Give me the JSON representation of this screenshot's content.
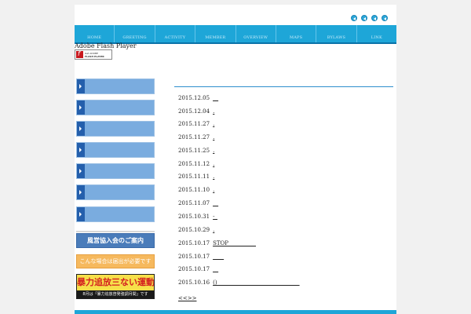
{
  "nav": {
    "items": [
      {
        "label": "HOME"
      },
      {
        "label": "GREETING"
      },
      {
        "label": "ACTIVITY"
      },
      {
        "label": "MEMBER"
      },
      {
        "label": "OVERVIEW"
      },
      {
        "label": "MAPS"
      },
      {
        "label": "BYLAWS"
      },
      {
        "label": "LINK"
      }
    ]
  },
  "flash": {
    "text": "Adobe Flash Player",
    "logo_line1": "Get ADOBE",
    "logo_line2": "FLASH PLAYER"
  },
  "sidebar": {
    "menu_count": 7,
    "banners": {
      "banner1": "風営協入会のご案内",
      "banner2": "こんな場合は届出が必要です",
      "banner3_main": "暴力追放三ない運動+1",
      "banner3_sub": "8月は「暴力追放啓発強調月間」です"
    }
  },
  "news": {
    "items": [
      {
        "date": "2015.12.05",
        "title": "__"
      },
      {
        "date": "2015.12.04",
        "title": "."
      },
      {
        "date": "2015.11.27",
        "title": "."
      },
      {
        "date": "2015.11.27",
        "title": "."
      },
      {
        "date": "2015.11.25",
        "title": "."
      },
      {
        "date": "2015.11.12",
        "title": "."
      },
      {
        "date": "2015.11.11",
        "title": "."
      },
      {
        "date": "2015.11.10",
        "title": "."
      },
      {
        "date": "2015.11.07",
        "title": "__"
      },
      {
        "date": "2015.10.31",
        "title": "-_"
      },
      {
        "date": "2015.10.29",
        "title": "."
      },
      {
        "date": "2015.10.17",
        "title": "STOP__________"
      },
      {
        "date": "2015.10.17",
        "title": "____"
      },
      {
        "date": "2015.10.17",
        "title": "__"
      },
      {
        "date": "2015.10.16",
        "title": "()______________________________"
      }
    ],
    "more": "<<>>"
  },
  "colors": {
    "nav": "#1ea6d8",
    "side_button": "#7aacdf",
    "side_tab": "#245fac",
    "news_line": "#2e8ecd"
  }
}
